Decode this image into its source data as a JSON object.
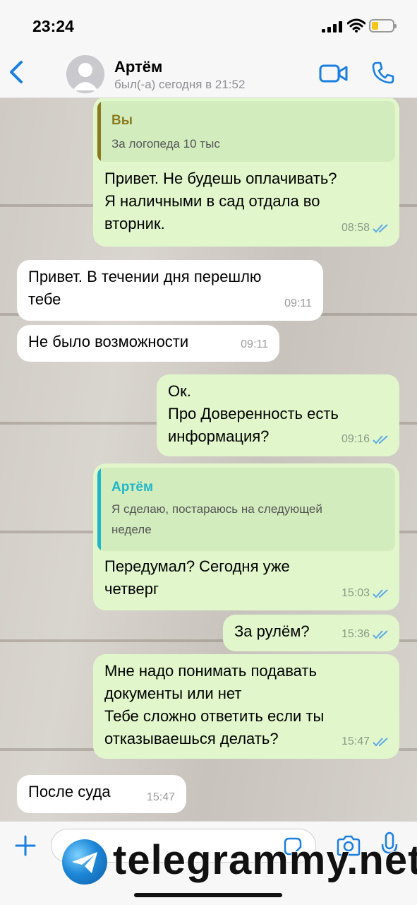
{
  "status_bar": {
    "time": "23:24"
  },
  "header": {
    "name": "Артём",
    "status": "был(-а) сегодня в 21:52"
  },
  "messages": [
    {
      "dir": "out",
      "reply_author": "Вы",
      "reply_text": "За логопеда 10 тыс",
      "text": "Привет. Не будешь оплачивать?\nЯ наличными в сад отдала во\nвторник.",
      "time": "08:58",
      "read": true
    },
    {
      "dir": "in",
      "text": "Привет. В течении дня перешлю\nтебе",
      "time": "09:11"
    },
    {
      "dir": "in",
      "text": "Не было возможности",
      "time": "09:11"
    },
    {
      "dir": "out",
      "text": "Ок.\nПро Доверенность есть\nинформация?",
      "time": "09:16",
      "read": true
    },
    {
      "dir": "out",
      "reply_author": "Артём",
      "reply_text": "Я сделаю, постараюсь на следующей\nнеделе",
      "text": "Передумал? Сегодня уже\nчетверг",
      "time": "15:03",
      "read": true
    },
    {
      "dir": "out",
      "text": "За рулём?",
      "time": "15:36",
      "read": true
    },
    {
      "dir": "out",
      "text": "Мне надо понимать подавать\nдокументы или нет\nТебе сложно ответить если ты\nотказываешься делать?",
      "time": "15:47",
      "read": true
    },
    {
      "dir": "in",
      "text": "После суда",
      "time": "15:47"
    }
  ],
  "colors": {
    "accent": "#1a7fe0",
    "out_bubble": "#e1f7cb",
    "in_bubble": "#ffffff",
    "reply_self": "#8a7a1e",
    "reply_contact": "#1fb6c9"
  },
  "icons": {
    "back": "chevron-left-icon",
    "video": "video-call-icon",
    "call": "phone-icon",
    "attach": "plus-icon",
    "sticker": "sticker-icon",
    "camera": "camera-icon",
    "mic": "microphone-icon"
  },
  "watermark": {
    "text": "telegrammy.net"
  }
}
